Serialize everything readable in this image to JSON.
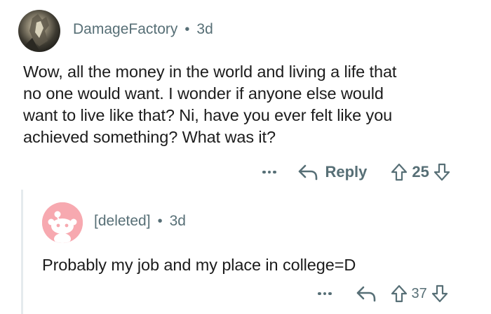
{
  "comments": [
    {
      "username": "DamageFactory",
      "separator": "•",
      "age": "3d",
      "body": [
        "Wow, all the money in the world and living a life that",
        "no one would want. I wonder if anyone else would",
        "want to live like that? Ni, have you ever felt like you",
        "achieved something? What was it?"
      ],
      "reply_label": "Reply",
      "score": "25",
      "icons": {
        "more": "more-options-icon",
        "reply": "reply-arrow-icon",
        "upvote": "upvote-arrow-icon",
        "downvote": "downvote-arrow-icon"
      }
    },
    {
      "username": "[deleted]",
      "separator": "•",
      "age": "3d",
      "body": [
        "Probably my job and my place in college=D"
      ],
      "score": "37",
      "icons": {
        "more": "more-options-icon",
        "reply": "reply-arrow-icon",
        "upvote": "upvote-arrow-icon",
        "downvote": "downvote-arrow-icon"
      }
    }
  ],
  "colors": {
    "meta_text": "#576f76",
    "body_text": "#1c1c1c",
    "thread_line": "#e5ebee",
    "deleted_avatar_bg": "#f7a9b0",
    "deleted_avatar_fg": "#ffffff"
  }
}
